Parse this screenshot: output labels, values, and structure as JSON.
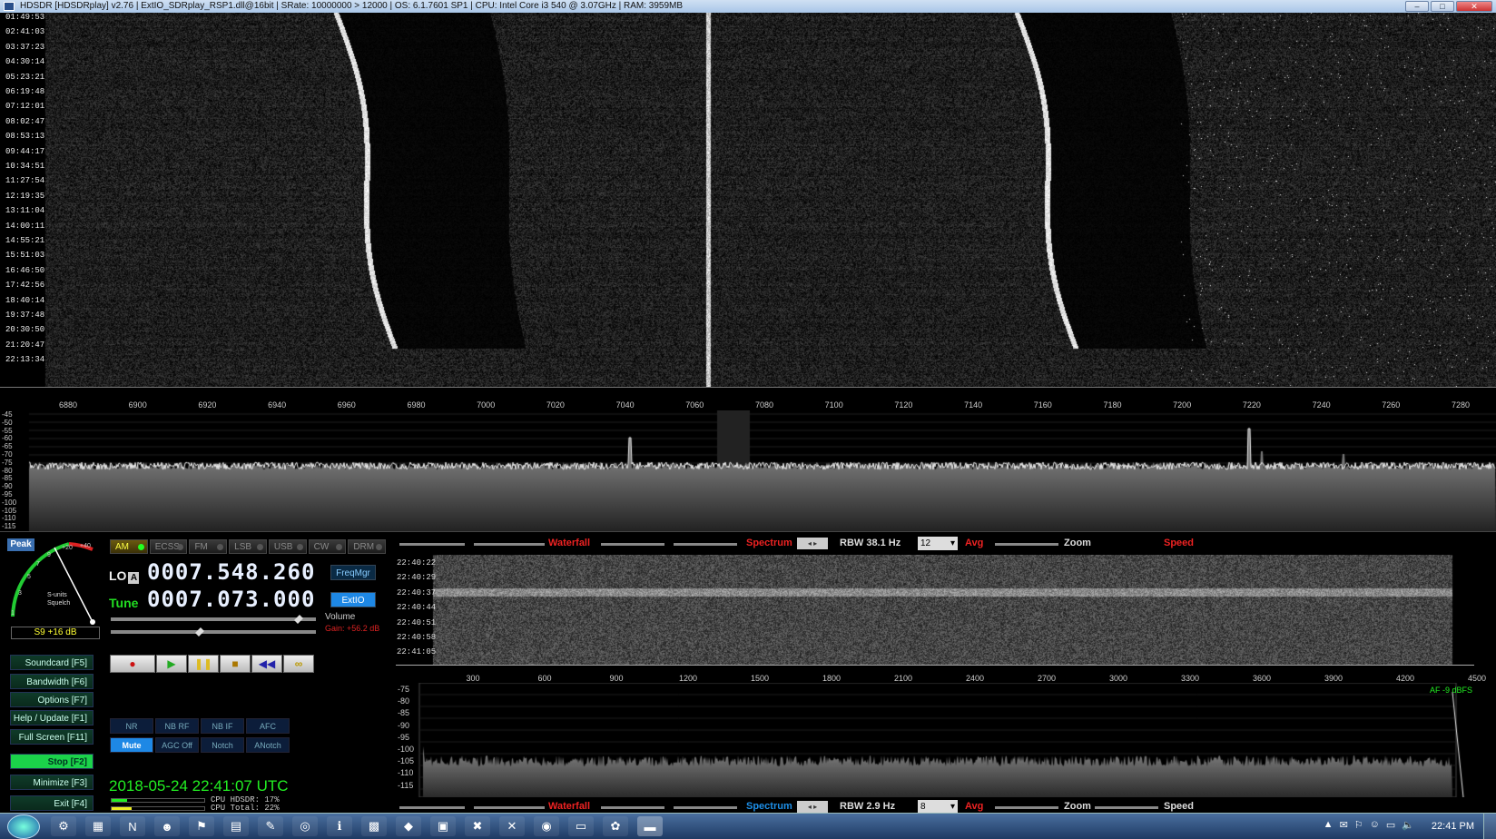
{
  "window": {
    "title": "HDSDR  [HDSDRplay]  v2.76  |  ExtIO_SDRplay_RSP1.dll@16bit  |  SRate: 10000000 > 12000  |  OS: 6.1.7601 SP1  |  CPU: Intel Core i3      540  @ 3.07GHz  |  RAM: 3959MB",
    "minimize": "–",
    "maximize": "□",
    "close": "✕"
  },
  "waterfall": {
    "timestamps": [
      "01:49:53",
      "02:41:03",
      "03:37:23",
      "04:30:14",
      "05:23:21",
      "06:19:48",
      "07:12:01",
      "08:02:47",
      "08:53:13",
      "09:44:17",
      "10:34:51",
      "11:27:54",
      "12:19:35",
      "13:11:04",
      "14:00:11",
      "14:55:21",
      "15:51:03",
      "16:46:50",
      "17:42:56",
      "18:40:14",
      "19:37:48",
      "20:30:50",
      "21:20:47",
      "22:13:34"
    ],
    "freq_ticks": [
      "6880",
      "6900",
      "6920",
      "6940",
      "6960",
      "6980",
      "7000",
      "7020",
      "7040",
      "7060",
      "7080",
      "7100",
      "7120",
      "7140",
      "7160",
      "7180",
      "7200",
      "7220",
      "7240",
      "7260",
      "7280"
    ]
  },
  "spectrum": {
    "db_ticks": [
      "-45",
      "-50",
      "-55",
      "-60",
      "-65",
      "-70",
      "-75",
      "-80",
      "-85",
      "-90",
      "-95",
      "-100",
      "-105",
      "-110",
      "-115"
    ]
  },
  "smeter": {
    "peak_label": "Peak",
    "scale_labels": [
      "1",
      "3",
      "5",
      "7",
      "9",
      "+20",
      "+40"
    ],
    "units_label": "S-units",
    "squelch_label": "Squelch",
    "reading": "S9 +16 dB",
    "colors": {
      "needle": "#ffffff",
      "scale_green": "#22cc33",
      "scale_red": "#dd2222"
    }
  },
  "modes": [
    {
      "label": "AM",
      "active": true
    },
    {
      "label": "ECSS",
      "active": false
    },
    {
      "label": "FM",
      "active": false
    },
    {
      "label": "LSB",
      "active": false
    },
    {
      "label": "USB",
      "active": false
    },
    {
      "label": "CW",
      "active": false
    },
    {
      "label": "DRM",
      "active": false
    }
  ],
  "frequency": {
    "lo_label": "LO",
    "lo_badge": "A",
    "lo_value": "0007.548.260",
    "tune_label": "Tune",
    "tune_value": "0007.073.000",
    "freqmgr_label": "FreqMgr",
    "extio_label": "ExtIO"
  },
  "sliders": {
    "volume_label": "Volume",
    "gain_label": "Gain: +56.2 dB",
    "top_level": 0.93,
    "volume_level": 0.43
  },
  "transport": {
    "record": "●",
    "play": "▶",
    "pause": "❚❚",
    "stop": "■",
    "rewind": "◀◀",
    "loop": "∞"
  },
  "function_buttons": [
    {
      "label": "Soundcard  [F5]",
      "active": false
    },
    {
      "label": "Bandwidth  [F6]",
      "active": false
    },
    {
      "label": "Options  [F7]",
      "active": false
    },
    {
      "label": "Help / Update  [F1]",
      "active": false
    },
    {
      "label": "Full Screen  [F11]",
      "active": false
    },
    {
      "label": "Stop  [F2]",
      "active": true
    },
    {
      "label": "Minimize  [F3]",
      "active": false
    },
    {
      "label": "Exit  [F4]",
      "active": false
    }
  ],
  "dsp": {
    "row1": [
      "NR",
      "NB RF",
      "NB IF",
      "AFC"
    ],
    "row2": [
      {
        "label": "Mute",
        "active": true
      },
      {
        "label": "AGC Off",
        "active": false
      },
      {
        "label": "Notch",
        "active": false
      },
      {
        "label": "ANotch",
        "active": false
      }
    ]
  },
  "status": {
    "datetime": "2018-05-24  22:41:07 UTC",
    "cpu_hdsdr": "CPU HDSDR:  17%",
    "cpu_total": "CPU Total:  22%",
    "cpu_hdsdr_fraction": 0.17,
    "cpu_total_fraction": 0.22
  },
  "controls_top": {
    "waterfall": "Waterfall",
    "spectrum": "Spectrum",
    "arrows": "◂ ▸",
    "rbw": "RBW  38.1 Hz",
    "avg_value": "12",
    "avg": "Avg",
    "zoom": "Zoom",
    "speed": "Speed"
  },
  "controls_bottom": {
    "waterfall": "Waterfall",
    "spectrum": "Spectrum",
    "arrows": "◂ ▸",
    "rbw": "RBW   2.9 Hz",
    "avg_value": "8",
    "avg": "Avg",
    "zoom": "Zoom",
    "speed": "Speed"
  },
  "audio": {
    "timestamps": [
      "22:40:22",
      "22:40:29",
      "22:40:37",
      "22:40:44",
      "22:40:51",
      "22:40:58",
      "22:41:05"
    ],
    "freq_ticks": [
      "300",
      "600",
      "900",
      "1200",
      "1500",
      "1800",
      "2100",
      "2400",
      "2700",
      "3000",
      "3300",
      "3600",
      "3900",
      "4200",
      "4500"
    ],
    "db_ticks": [
      "-75",
      "-80",
      "-85",
      "-90",
      "-95",
      "-100",
      "-105",
      "-110",
      "-115"
    ],
    "af_label": "AF -9 dBFS"
  },
  "taskbar": {
    "apps": [
      "⚙",
      "▦",
      "N",
      "☻",
      "⚑",
      "▤",
      "✎",
      "◎",
      "ℹ",
      "▩",
      "◆",
      "▣",
      "✖",
      "✕",
      "◉",
      "▭",
      "✿",
      "▬"
    ],
    "tray": [
      "▲",
      "✉",
      "⚐",
      "☺",
      "▭",
      "🔈"
    ],
    "clock": "22:41 PM"
  }
}
